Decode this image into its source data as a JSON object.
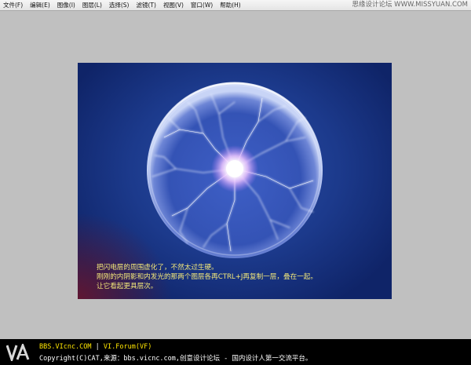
{
  "menubar": {
    "items": [
      "文件(F)",
      "编辑(E)",
      "图像(I)",
      "图层(L)",
      "选择(S)",
      "滤镜(T)",
      "视图(V)",
      "窗口(W)",
      "帮助(H)"
    ],
    "watermark": "思缘设计论坛 WWW.MISSYUAN.COM"
  },
  "canvas": {
    "caption": [
      "把闪电层的周围虚化了，不然太过生硬。",
      "刚刚的内阴影和内发光的那两个图层各再CTRL+J再复制一层，叠在一起。",
      "让它看起更具层次。"
    ]
  },
  "footer": {
    "site": "BBS.VIcnc.COM",
    "separator": "|",
    "forum": "VI.Forum(VF)",
    "copyright": "Copyright(C)CAT,来源：bbs.vicnc.com,创意设计论坛 - 国内设计人第一交流平台。"
  }
}
